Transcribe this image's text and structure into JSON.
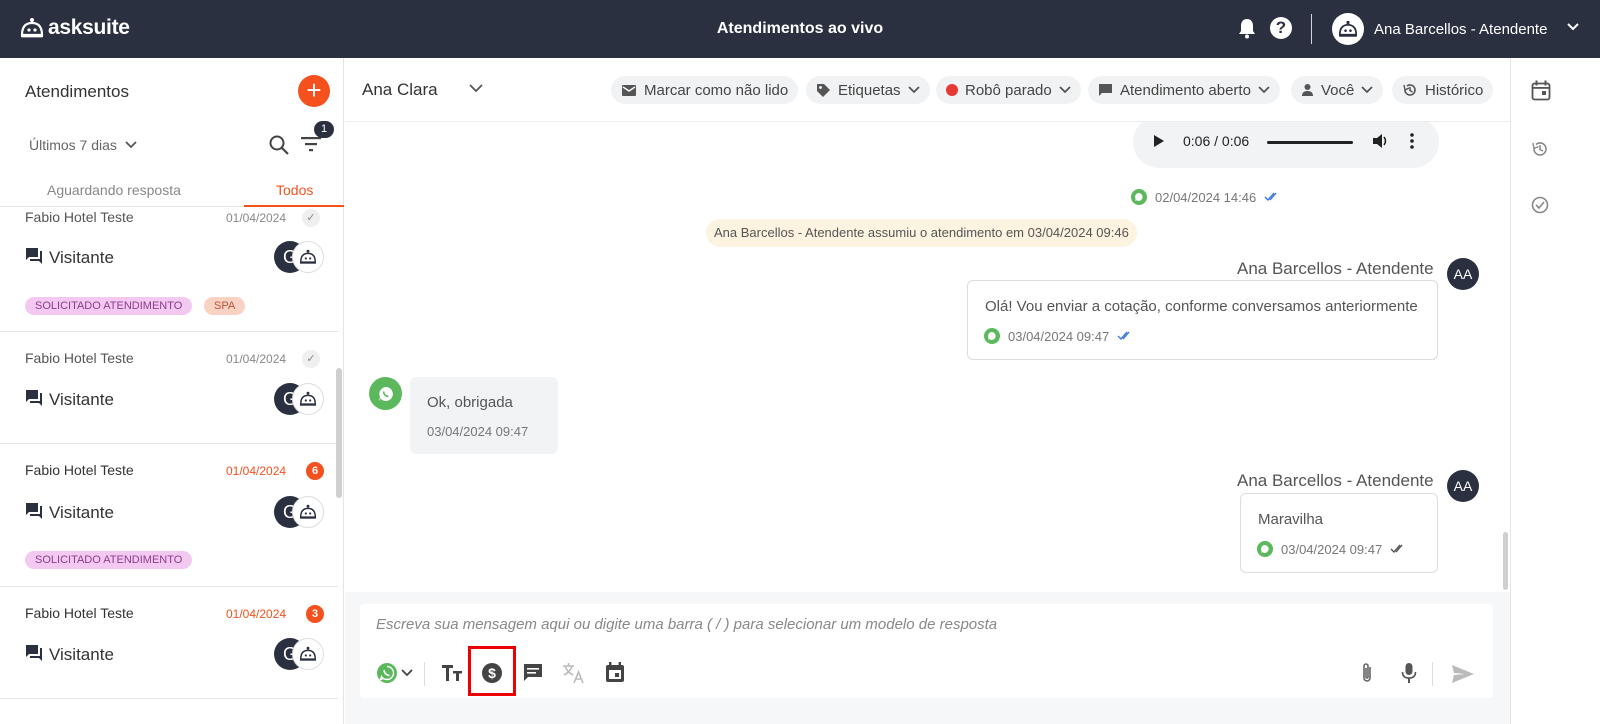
{
  "header": {
    "logo_text": "asksuite",
    "page_title": "Atendimentos ao vivo",
    "help_label": "?",
    "user_name": "Ana Barcellos - Atendente"
  },
  "left": {
    "title": "Atendimentos",
    "add_label": "+",
    "period": "Últimos 7 dias",
    "filter_count": "1",
    "tabs": [
      "Aguardando resposta",
      "Todos"
    ],
    "conversations": [
      {
        "name": "Fabio Hotel Teste",
        "date": "01/04/2024",
        "status": "read",
        "visitor": "Visitante",
        "avatar_letter": "G",
        "tags": [
          "SOLICITADO ATENDIMENTO",
          "SPA"
        ]
      },
      {
        "name": "Fabio Hotel Teste",
        "date": "01/04/2024",
        "status": "read",
        "visitor": "Visitante",
        "avatar_letter": "G",
        "tags": []
      },
      {
        "name": "Fabio Hotel Teste",
        "date": "01/04/2024",
        "status": "unread",
        "count": "6",
        "visitor": "Visitante",
        "avatar_letter": "G",
        "tags": [
          "SOLICITADO ATENDIMENTO"
        ]
      },
      {
        "name": "Fabio Hotel Teste",
        "date": "01/04/2024",
        "status": "unread",
        "count": "3",
        "visitor": "Visitante",
        "avatar_letter": "G",
        "tags": []
      }
    ]
  },
  "chat_header": {
    "contact": "Ana Clara",
    "actions": [
      "Marcar como não lido",
      "Etiquetas",
      "Robô parado",
      "Atendimento aberto",
      "Você",
      "Histórico"
    ]
  },
  "messages": {
    "audio_time": "0:06 / 0:06",
    "audio_meta": "02/04/2024 14:46",
    "system": "Ana Barcellos - Atendente assumiu o atendimento em 03/04/2024 09:46",
    "out1": {
      "sender": "Ana Barcellos - Atendente",
      "initials": "AA",
      "text": "Olá! Vou enviar a cotação, conforme conversamos anteriormente",
      "time": "03/04/2024 09:47"
    },
    "in1": {
      "text": "Ok, obrigada",
      "time": "03/04/2024 09:47"
    },
    "out2": {
      "sender": "Ana Barcellos - Atendente",
      "initials": "AA",
      "text": "Maravilha",
      "time": "03/04/2024 09:47"
    }
  },
  "composer": {
    "placeholder": "Escreva sua mensagem aqui ou digite uma barra ( / ) para selecionar um modelo de resposta"
  },
  "colors": {
    "brand_dark": "#2b3040",
    "accent": "#f4511e",
    "whatsapp": "#5cb85c",
    "highlight": "#e00000"
  }
}
